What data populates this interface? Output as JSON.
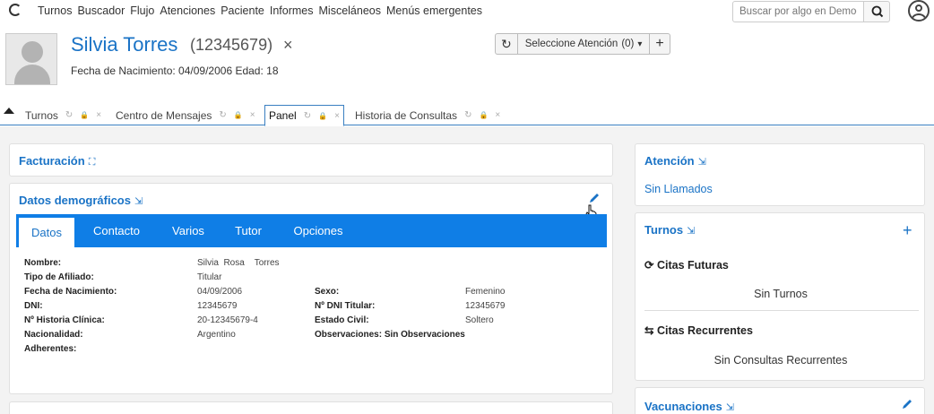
{
  "nav": {
    "items": [
      "Turnos",
      "Buscador",
      "Flujo",
      "Atenciones",
      "Paciente",
      "Informes",
      "Misceláneos",
      "Menús emergentes"
    ],
    "search_placeholder": "Buscar por algo en Democ"
  },
  "patient": {
    "name": "Silvia Torres",
    "id": "(12345679)",
    "close": "×",
    "birth_line": "Fecha de Nacimiento: 04/09/2006 Edad: 18"
  },
  "attention_selector": {
    "history_icon": "↻",
    "label": "Seleccione Atención",
    "count": "(0)",
    "caret": "▾",
    "plus": "+"
  },
  "page_tabs": [
    {
      "label": "Turnos"
    },
    {
      "label": "Centro de Mensajes"
    },
    {
      "label": "Panel"
    },
    {
      "label": "Historia de Consultas"
    }
  ],
  "tab_icons": {
    "refresh": "↻",
    "lock": "🔒",
    "close": "×"
  },
  "facturacion": {
    "title": "Facturación",
    "icon": "⛶"
  },
  "demograficos": {
    "title": "Datos demográficos",
    "icon": "⇲",
    "tabs": [
      "Datos",
      "Contacto",
      "Varios",
      "Tutor",
      "Opciones"
    ],
    "fields_left": [
      {
        "label": "Nombre:",
        "value": "Silvia  Rosa    Torres"
      },
      {
        "label": "Tipo de Afiliado:",
        "value": "Titular"
      },
      {
        "label": "Fecha de Nacimiento:",
        "value": "04/09/2006"
      },
      {
        "label": "DNI:",
        "value": "12345679"
      },
      {
        "label": "Nº Historia Clínica:",
        "value": "20-12345679-4"
      },
      {
        "label": "Nacionalidad:",
        "value": "Argentino"
      },
      {
        "label": "Adherentes:",
        "value": ""
      }
    ],
    "fields_right": [
      {
        "label": "Sexo:",
        "value": "Femenino"
      },
      {
        "label": "Nº DNI Titular:",
        "value": "12345679"
      },
      {
        "label": "Estado Civil:",
        "value": "Soltero"
      },
      {
        "label": "Observaciones: Sin Observaciones",
        "value": ""
      }
    ]
  },
  "atencion": {
    "title": "Atención",
    "icon": "⇲",
    "status": "Sin Llamados"
  },
  "turnos": {
    "title": "Turnos",
    "icon": "⇲",
    "plus": "+",
    "citas_futuras": {
      "icon": "⟳",
      "title": "Citas Futuras",
      "empty": "Sin Turnos"
    },
    "citas_recurrentes": {
      "icon": "⇆",
      "title": "Citas Recurrentes",
      "empty": "Sin Consultas Recurrentes"
    }
  },
  "vacunaciones": {
    "title": "Vacunaciones",
    "icon": "⇲"
  },
  "colors": {
    "accent": "#1a73c6",
    "tab_bar": "#0f7ee6"
  }
}
